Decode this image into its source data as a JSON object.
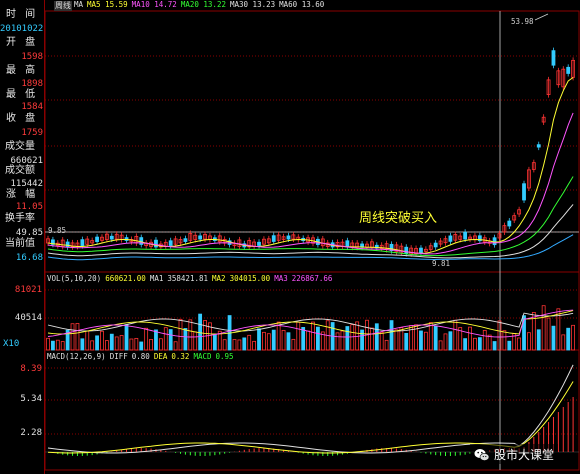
{
  "window": {
    "tab_title": "周线"
  },
  "sidebar": {
    "time_label": "时 间",
    "time_value": "20101022",
    "open_label": "开 盘",
    "open_value": "1598",
    "high_label": "最 高",
    "high_value": "1898",
    "low_label": "最 低",
    "low_value": "1584",
    "close_label": "收 盘",
    "close_value": "1759",
    "volume_label": "成交量",
    "volume_value": "660621",
    "amount_label": "成交额",
    "amount_value": "115442",
    "change_label": "涨 幅",
    "change_value": "11.05",
    "turnover_label": "换手率",
    "turnover_value": "49.85",
    "current_label": "当前值",
    "current_value": "16.68"
  },
  "price_legend": [
    {
      "text": "MA",
      "color": "#e0e0e0"
    },
    {
      "text": "MA5 15.59",
      "color": "#ffff33"
    },
    {
      "text": "MA10 14.72",
      "color": "#ff55ff"
    },
    {
      "text": "MA20 13.22",
      "color": "#33ff33"
    },
    {
      "text": "MA30 13.23",
      "color": "#e0e0e0"
    },
    {
      "text": "MA60 13.60",
      "color": "#e0e0e0"
    }
  ],
  "price_annotations": {
    "peak": "53.98",
    "inline_value": "9.85",
    "low": "9.81"
  },
  "annotation": "周线突破买入",
  "vol_legend": [
    {
      "text": "VOL(5,10,20)",
      "color": "#e0e0e0"
    },
    {
      "text": "660621.00",
      "color": "#ffff33"
    },
    {
      "text": "MA1",
      "color": "#e0e0e0"
    },
    {
      "text": "358421.81",
      "color": "#e0e0e0"
    },
    {
      "text": "MA2",
      "color": "#ffff33"
    },
    {
      "text": "304015.00",
      "color": "#ffff33"
    },
    {
      "text": "MA3",
      "color": "#ff55ff"
    },
    {
      "text": "226867.66",
      "color": "#ff55ff"
    }
  ],
  "vol_axis": {
    "top": "81021",
    "mid": "40514",
    "unit": "X10"
  },
  "macd_legend": [
    {
      "text": "MACD(12,26,9)",
      "color": "#e0e0e0"
    },
    {
      "text": "DIFF",
      "color": "#e0e0e0"
    },
    {
      "text": "0.80",
      "color": "#e0e0e0"
    },
    {
      "text": "DEA",
      "color": "#ffff33"
    },
    {
      "text": "0.32",
      "color": "#ffff33"
    },
    {
      "text": "MACD",
      "color": "#33ff33"
    },
    {
      "text": "0.95",
      "color": "#33ff33"
    }
  ],
  "macd_axis": {
    "top": "8.39",
    "mid": "5.34",
    "low": "2.28"
  },
  "watermark": "股市大课堂",
  "colors": {
    "up": "#ff3333",
    "down": "#33ccff",
    "ma5": "#ffff33",
    "ma10": "#ff55ff",
    "ma20": "#33ff33",
    "grid": "#8a0000"
  }
}
